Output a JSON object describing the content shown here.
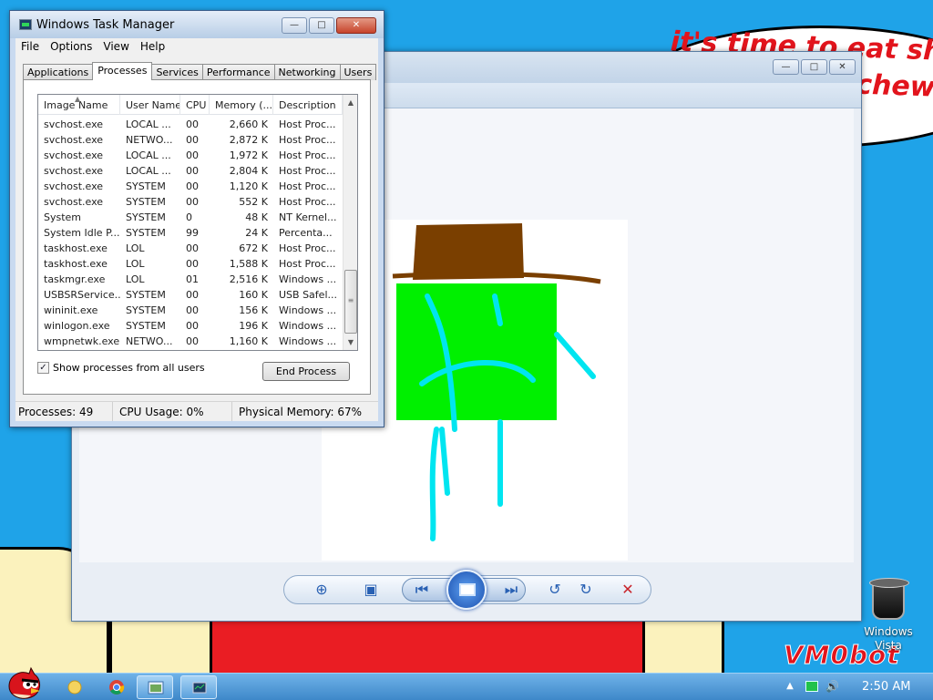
{
  "wallpaper": {
    "bubble_line1": "it's time to eat shit",
    "bubble_line2": "chew",
    "watermark": "VM0bot"
  },
  "desktop": {
    "icon_label": "Windows Vista",
    "icon_name": "recycle-bin-icon"
  },
  "photo_viewer": {
    "help_icon": "?",
    "controls": [
      "zoom-icon",
      "actual-size-icon",
      "previous-icon",
      "slideshow-icon",
      "next-icon",
      "rotate-left-icon",
      "rotate-right-icon",
      "delete-icon"
    ]
  },
  "task_manager": {
    "title": "Windows Task Manager",
    "menu": [
      "File",
      "Options",
      "View",
      "Help"
    ],
    "tabs": [
      "Applications",
      "Processes",
      "Services",
      "Performance",
      "Networking",
      "Users"
    ],
    "active_tab": "Processes",
    "columns": [
      "Image Name",
      "User Name",
      "CPU",
      "Memory (...",
      "Description"
    ],
    "processes": [
      {
        "image": "svchost.exe",
        "user": "LOCAL ...",
        "cpu": "00",
        "mem": "2,660 K",
        "desc": "Host Proc..."
      },
      {
        "image": "svchost.exe",
        "user": "NETWO...",
        "cpu": "00",
        "mem": "2,872 K",
        "desc": "Host Proc..."
      },
      {
        "image": "svchost.exe",
        "user": "LOCAL ...",
        "cpu": "00",
        "mem": "1,972 K",
        "desc": "Host Proc..."
      },
      {
        "image": "svchost.exe",
        "user": "LOCAL ...",
        "cpu": "00",
        "mem": "2,804 K",
        "desc": "Host Proc..."
      },
      {
        "image": "svchost.exe",
        "user": "SYSTEM",
        "cpu": "00",
        "mem": "1,120 K",
        "desc": "Host Proc..."
      },
      {
        "image": "svchost.exe",
        "user": "SYSTEM",
        "cpu": "00",
        "mem": "552 K",
        "desc": "Host Proc..."
      },
      {
        "image": "System",
        "user": "SYSTEM",
        "cpu": "0",
        "mem": "48 K",
        "desc": "NT Kernel..."
      },
      {
        "image": "System Idle P...",
        "user": "SYSTEM",
        "cpu": "99",
        "mem": "24 K",
        "desc": "Percenta..."
      },
      {
        "image": "taskhost.exe",
        "user": "LOL",
        "cpu": "00",
        "mem": "672 K",
        "desc": "Host Proc..."
      },
      {
        "image": "taskhost.exe",
        "user": "LOL",
        "cpu": "00",
        "mem": "1,588 K",
        "desc": "Host Proc..."
      },
      {
        "image": "taskmgr.exe",
        "user": "LOL",
        "cpu": "01",
        "mem": "2,516 K",
        "desc": "Windows ..."
      },
      {
        "image": "USBSRService...",
        "user": "SYSTEM",
        "cpu": "00",
        "mem": "160 K",
        "desc": "USB Safel..."
      },
      {
        "image": "wininit.exe",
        "user": "SYSTEM",
        "cpu": "00",
        "mem": "156 K",
        "desc": "Windows ..."
      },
      {
        "image": "winlogon.exe",
        "user": "SYSTEM",
        "cpu": "00",
        "mem": "196 K",
        "desc": "Windows ..."
      },
      {
        "image": "wmpnetwk.exe",
        "user": "NETWO...",
        "cpu": "00",
        "mem": "1,160 K",
        "desc": "Windows ..."
      }
    ],
    "show_all_label": "Show processes from all users",
    "show_all_checked": true,
    "end_process_label": "End Process",
    "status": {
      "processes": "Processes: 49",
      "cpu": "CPU Usage: 0%",
      "memory": "Physical Memory: 67%"
    }
  },
  "taskbar": {
    "clock": "2:50 AM"
  }
}
